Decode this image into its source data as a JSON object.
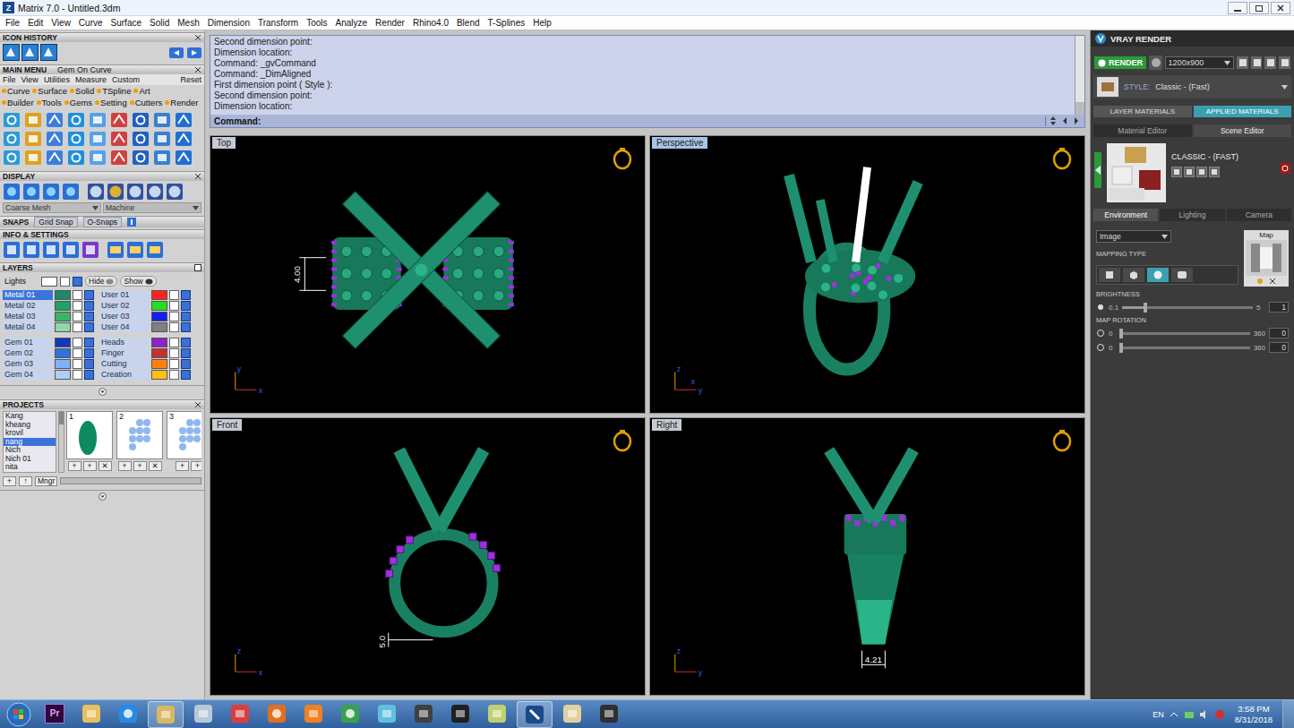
{
  "window": {
    "title": "Matrix 7.0 - Untitled.3dm",
    "app_icon": "Z"
  },
  "menu_bar": [
    "File",
    "Edit",
    "View",
    "Curve",
    "Surface",
    "Solid",
    "Mesh",
    "Dimension",
    "Transform",
    "Tools",
    "Analyze",
    "Render",
    "Rhino4.0",
    "Blend",
    "T-Splines",
    "Help"
  ],
  "left_panel": {
    "icon_history": {
      "title": "ICON HISTORY"
    },
    "main_menu": {
      "title": "MAIN MENU",
      "current": "Gem On Curve",
      "submenu": [
        "File",
        "View",
        "Utilities",
        "Measure",
        "Custom"
      ],
      "reset": "Reset",
      "categories": [
        [
          "Curve",
          "Surface",
          "Solid",
          "TSpline",
          "Art"
        ],
        [
          "Builder",
          "Tools",
          "Gems",
          "Setting",
          "Cutters",
          "Render"
        ]
      ]
    },
    "display": {
      "title": "DISPLAY",
      "mesh": "Coarse Mesh",
      "mode": "Machine"
    },
    "snaps": {
      "title": "SNAPS",
      "grid_snap": "Grid Snap",
      "o_snaps": "O-Snaps"
    },
    "info": {
      "title": "INFO & SETTINGS"
    },
    "layers": {
      "title": "LAYERS",
      "lights": {
        "label": "Lights",
        "hide": "Hide",
        "show": "Show"
      },
      "blocks": [
        {
          "left": [
            {
              "name": "Metal 01",
              "color": "#1b8a6b",
              "selected": true
            },
            {
              "name": "Metal 02",
              "color": "#22a066",
              "selected": false
            },
            {
              "name": "Metal 03",
              "color": "#38b46a",
              "selected": false
            },
            {
              "name": "Metal 04",
              "color": "#8fd8a8",
              "selected": false
            }
          ],
          "right": [
            {
              "name": "User 01",
              "color": "#ff2020",
              "selected": false
            },
            {
              "name": "User 02",
              "color": "#20e020",
              "selected": false
            },
            {
              "name": "User 03",
              "color": "#1020f0",
              "selected": false
            },
            {
              "name": "User 04",
              "color": "#808080",
              "selected": false
            }
          ]
        },
        {
          "left": [
            {
              "name": "Gem 01",
              "color": "#1038b8",
              "selected": false
            },
            {
              "name": "Gem 02",
              "color": "#3070e0",
              "selected": false
            },
            {
              "name": "Gem 03",
              "color": "#80b0f8",
              "selected": false
            },
            {
              "name": "Gem 04",
              "color": "#b0ccf8",
              "selected": false
            }
          ],
          "right": [
            {
              "name": "Heads",
              "color": "#9020c8",
              "selected": false
            },
            {
              "name": "Finger",
              "color": "#c83030",
              "selected": false
            },
            {
              "name": "Cutting",
              "color": "#ff8010",
              "selected": false
            },
            {
              "name": "Creation",
              "color": "#ffc010",
              "selected": false
            }
          ]
        }
      ]
    },
    "projects": {
      "title": "PROJECTS",
      "names": [
        {
          "name": "Kang",
          "selected": false
        },
        {
          "name": "kheang",
          "selected": false
        },
        {
          "name": "krovil",
          "selected": false
        },
        {
          "name": "nang",
          "selected": true
        },
        {
          "name": "Nich",
          "selected": false
        },
        {
          "name": "Nich 01",
          "selected": false
        },
        {
          "name": "nita",
          "selected": false
        }
      ],
      "thumbnails": [
        {
          "number": "1",
          "kind": "emerald",
          "buttons": [
            "+",
            "+",
            "✕"
          ]
        },
        {
          "number": "2",
          "kind": "cluster",
          "buttons": [
            "+",
            "+",
            "✕"
          ]
        },
        {
          "number": "3",
          "kind": "cluster",
          "buttons": [
            "+",
            "+"
          ]
        }
      ],
      "buttons": [
        "+",
        "↑",
        "Mngr"
      ]
    }
  },
  "command": {
    "lines": [
      "Second dimension point:",
      "Dimension location:",
      "Command: _gvCommand",
      "Command: _DimAligned",
      "First dimension point ( Style ):",
      "Second dimension point:",
      "Dimension location:"
    ],
    "prompt": "Command:"
  },
  "viewports": [
    {
      "label": "Top",
      "kind": "top",
      "selected": false,
      "dimension": "4.00",
      "axes": [
        "y",
        "x"
      ]
    },
    {
      "label": "Perspective",
      "kind": "perspective",
      "selected": true,
      "axes": [
        "z",
        "y",
        "x"
      ]
    },
    {
      "label": "Front",
      "kind": "front",
      "selected": false,
      "dimension": "5.0",
      "axes": [
        "z",
        "x"
      ]
    },
    {
      "label": "Right",
      "kind": "right",
      "selected": false,
      "dimension": "4.21",
      "axes": [
        "z",
        "y"
      ]
    }
  ],
  "vray": {
    "title": "VRAY RENDER",
    "render": "RENDER",
    "resolution": "1200x900",
    "style_label": "STYLE:",
    "style": "Classic - (Fast)",
    "material_tabs": [
      {
        "label": "LAYER MATERIALS",
        "selected": false
      },
      {
        "label": "APPLIED MATERIALS",
        "selected": true
      }
    ],
    "editor_tabs": [
      {
        "label": "Material Editor",
        "selected": false
      },
      {
        "label": "Scene Editor",
        "selected": true
      }
    ],
    "preset": "CLASSIC - (FAST)",
    "env_tabs": [
      {
        "label": "Environment",
        "selected": true
      },
      {
        "label": "Lighting",
        "selected": false
      },
      {
        "label": "Camera",
        "selected": false
      }
    ],
    "source": "Image",
    "mapping_label": "MAPPING TYPE",
    "mapping_types": [
      {
        "selected": false
      },
      {
        "selected": false
      },
      {
        "selected": true
      },
      {
        "selected": false
      }
    ],
    "map_label": "Map",
    "brightness": {
      "label": "BRIGHTNESS",
      "min": "0.1",
      "max": "5",
      "value": "1",
      "level": 0.18
    },
    "rotation": {
      "label": "MAP ROTATION",
      "sliders": [
        {
          "min": "0",
          "max": "360",
          "value": "0",
          "level": 0
        },
        {
          "min": "0",
          "max": "360",
          "value": "0",
          "level": 0
        }
      ]
    }
  },
  "taskbar": {
    "apps": [
      {
        "kind": "premiere",
        "label": "Pr",
        "active": false
      },
      {
        "kind": "folder",
        "active": false
      },
      {
        "kind": "ie",
        "active": false
      },
      {
        "kind": "explorer",
        "active": true
      },
      {
        "kind": "calculator",
        "active": false
      },
      {
        "kind": "snipping",
        "active": false
      },
      {
        "kind": "firefox",
        "active": false
      },
      {
        "kind": "media",
        "active": false
      },
      {
        "kind": "chrome",
        "active": false
      },
      {
        "kind": "eraser",
        "active": false
      },
      {
        "kind": "pen",
        "active": false
      },
      {
        "kind": "figure",
        "active": false
      },
      {
        "kind": "notes",
        "active": false
      },
      {
        "kind": "matrix",
        "active": true
      },
      {
        "kind": "paint",
        "active": false
      },
      {
        "kind": "capture",
        "active": false
      }
    ],
    "lang": "EN",
    "time": "3:58 PM",
    "date": "8/31/2018"
  }
}
